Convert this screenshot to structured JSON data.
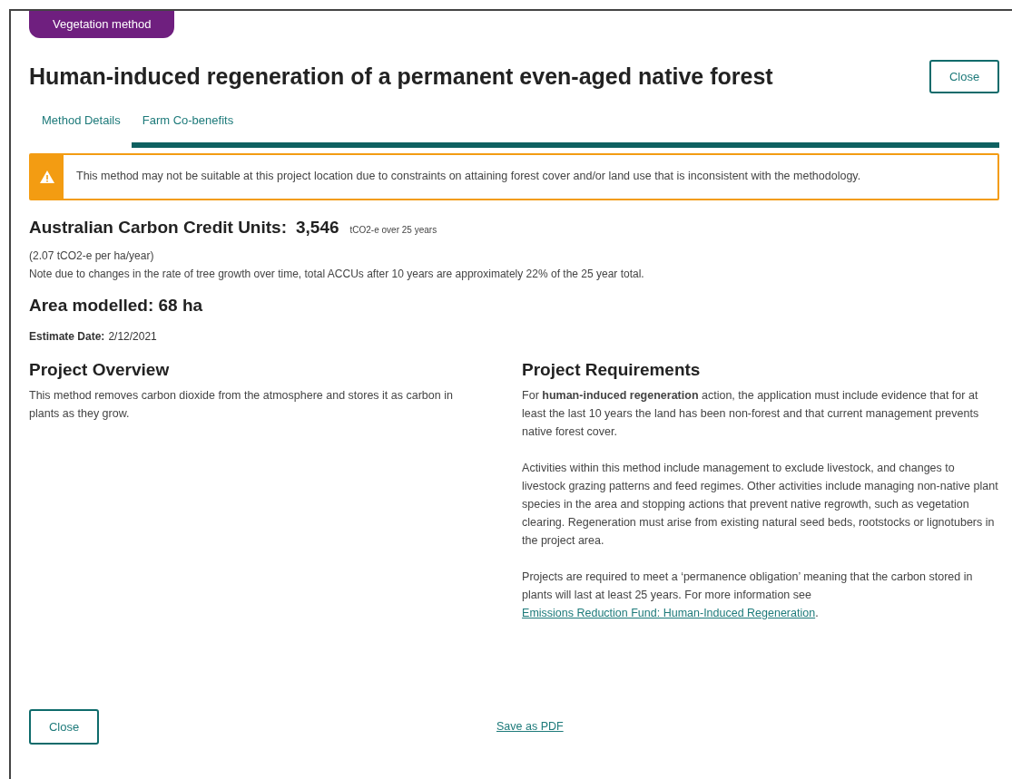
{
  "badge": "Vegetation method",
  "title": "Human-induced regeneration of a permanent even-aged native forest",
  "close_top": "Close",
  "tabs": [
    {
      "label": "Method Details",
      "selected": false
    },
    {
      "label": "Farm Co-benefits",
      "selected": true
    }
  ],
  "warning": {
    "text": "This method may not be suitable at this project location due to constraints on attaining forest cover and/or land use that is inconsistent with the methodology."
  },
  "accu": {
    "label": "Australian Carbon Credit Units:",
    "value": "3,546",
    "unit": "tCO2-e over 25 years",
    "rate": "(2.07 tCO2-e per ha/year)",
    "note": "Note due to changes in the rate of tree growth over time, total ACCUs after 10 years are approximately 22% of the 25 year total."
  },
  "area": "Area modelled: 68 ha",
  "estimate": {
    "label": "Estimate Date:",
    "value": "2/12/2021"
  },
  "overview": {
    "heading": "Project Overview",
    "text": "This method removes carbon dioxide from the atmosphere and stores it as carbon in plants as they grow."
  },
  "requirements": {
    "heading": "Project Requirements",
    "paragraphs": [
      {
        "text": "For **human-induced regeneration** action, the application must include evidence that for at least the last 10 years the land has been non-forest and that current management prevents native forest cover."
      },
      {
        "text": "Activities within this method include management to exclude livestock, and changes to livestock grazing patterns and feed regimes. Other activities include managing non-native plant species in the area and stopping actions that prevent native regrowth, such as vegetation clearing. Regeneration must arise from existing natural seed beds, rootstocks or lignotubers in the project area."
      },
      {
        "text": "Projects are required to meet a ‘permanence obligation’ meaning that the carbon stored in plants will last at least 25 years. For more information see",
        "link": "Emissions Reduction Fund: Human-Induced Regeneration",
        "after": "."
      }
    ]
  },
  "close_bottom": "Close",
  "save_pdf": "Save as PDF"
}
